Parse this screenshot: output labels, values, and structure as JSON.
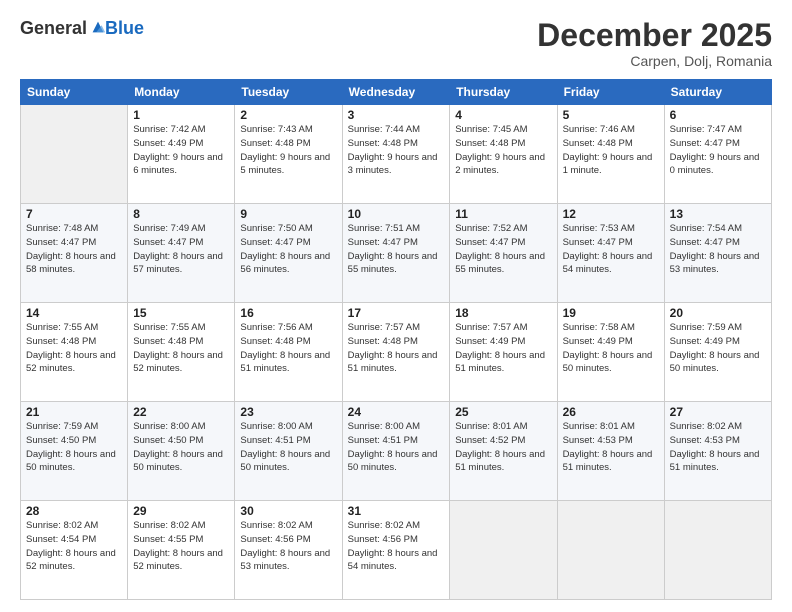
{
  "header": {
    "logo_general": "General",
    "logo_blue": "Blue",
    "month_title": "December 2025",
    "location": "Carpen, Dolj, Romania"
  },
  "days_of_week": [
    "Sunday",
    "Monday",
    "Tuesday",
    "Wednesday",
    "Thursday",
    "Friday",
    "Saturday"
  ],
  "weeks": [
    [
      {
        "day": "",
        "sunrise": "",
        "sunset": "",
        "daylight": "",
        "empty": true
      },
      {
        "day": "1",
        "sunrise": "Sunrise: 7:42 AM",
        "sunset": "Sunset: 4:49 PM",
        "daylight": "Daylight: 9 hours and 6 minutes."
      },
      {
        "day": "2",
        "sunrise": "Sunrise: 7:43 AM",
        "sunset": "Sunset: 4:48 PM",
        "daylight": "Daylight: 9 hours and 5 minutes."
      },
      {
        "day": "3",
        "sunrise": "Sunrise: 7:44 AM",
        "sunset": "Sunset: 4:48 PM",
        "daylight": "Daylight: 9 hours and 3 minutes."
      },
      {
        "day": "4",
        "sunrise": "Sunrise: 7:45 AM",
        "sunset": "Sunset: 4:48 PM",
        "daylight": "Daylight: 9 hours and 2 minutes."
      },
      {
        "day": "5",
        "sunrise": "Sunrise: 7:46 AM",
        "sunset": "Sunset: 4:48 PM",
        "daylight": "Daylight: 9 hours and 1 minute."
      },
      {
        "day": "6",
        "sunrise": "Sunrise: 7:47 AM",
        "sunset": "Sunset: 4:47 PM",
        "daylight": "Daylight: 9 hours and 0 minutes."
      }
    ],
    [
      {
        "day": "7",
        "sunrise": "Sunrise: 7:48 AM",
        "sunset": "Sunset: 4:47 PM",
        "daylight": "Daylight: 8 hours and 58 minutes."
      },
      {
        "day": "8",
        "sunrise": "Sunrise: 7:49 AM",
        "sunset": "Sunset: 4:47 PM",
        "daylight": "Daylight: 8 hours and 57 minutes."
      },
      {
        "day": "9",
        "sunrise": "Sunrise: 7:50 AM",
        "sunset": "Sunset: 4:47 PM",
        "daylight": "Daylight: 8 hours and 56 minutes."
      },
      {
        "day": "10",
        "sunrise": "Sunrise: 7:51 AM",
        "sunset": "Sunset: 4:47 PM",
        "daylight": "Daylight: 8 hours and 55 minutes."
      },
      {
        "day": "11",
        "sunrise": "Sunrise: 7:52 AM",
        "sunset": "Sunset: 4:47 PM",
        "daylight": "Daylight: 8 hours and 55 minutes."
      },
      {
        "day": "12",
        "sunrise": "Sunrise: 7:53 AM",
        "sunset": "Sunset: 4:47 PM",
        "daylight": "Daylight: 8 hours and 54 minutes."
      },
      {
        "day": "13",
        "sunrise": "Sunrise: 7:54 AM",
        "sunset": "Sunset: 4:47 PM",
        "daylight": "Daylight: 8 hours and 53 minutes."
      }
    ],
    [
      {
        "day": "14",
        "sunrise": "Sunrise: 7:55 AM",
        "sunset": "Sunset: 4:48 PM",
        "daylight": "Daylight: 8 hours and 52 minutes."
      },
      {
        "day": "15",
        "sunrise": "Sunrise: 7:55 AM",
        "sunset": "Sunset: 4:48 PM",
        "daylight": "Daylight: 8 hours and 52 minutes."
      },
      {
        "day": "16",
        "sunrise": "Sunrise: 7:56 AM",
        "sunset": "Sunset: 4:48 PM",
        "daylight": "Daylight: 8 hours and 51 minutes."
      },
      {
        "day": "17",
        "sunrise": "Sunrise: 7:57 AM",
        "sunset": "Sunset: 4:48 PM",
        "daylight": "Daylight: 8 hours and 51 minutes."
      },
      {
        "day": "18",
        "sunrise": "Sunrise: 7:57 AM",
        "sunset": "Sunset: 4:49 PM",
        "daylight": "Daylight: 8 hours and 51 minutes."
      },
      {
        "day": "19",
        "sunrise": "Sunrise: 7:58 AM",
        "sunset": "Sunset: 4:49 PM",
        "daylight": "Daylight: 8 hours and 50 minutes."
      },
      {
        "day": "20",
        "sunrise": "Sunrise: 7:59 AM",
        "sunset": "Sunset: 4:49 PM",
        "daylight": "Daylight: 8 hours and 50 minutes."
      }
    ],
    [
      {
        "day": "21",
        "sunrise": "Sunrise: 7:59 AM",
        "sunset": "Sunset: 4:50 PM",
        "daylight": "Daylight: 8 hours and 50 minutes."
      },
      {
        "day": "22",
        "sunrise": "Sunrise: 8:00 AM",
        "sunset": "Sunset: 4:50 PM",
        "daylight": "Daylight: 8 hours and 50 minutes."
      },
      {
        "day": "23",
        "sunrise": "Sunrise: 8:00 AM",
        "sunset": "Sunset: 4:51 PM",
        "daylight": "Daylight: 8 hours and 50 minutes."
      },
      {
        "day": "24",
        "sunrise": "Sunrise: 8:00 AM",
        "sunset": "Sunset: 4:51 PM",
        "daylight": "Daylight: 8 hours and 50 minutes."
      },
      {
        "day": "25",
        "sunrise": "Sunrise: 8:01 AM",
        "sunset": "Sunset: 4:52 PM",
        "daylight": "Daylight: 8 hours and 51 minutes."
      },
      {
        "day": "26",
        "sunrise": "Sunrise: 8:01 AM",
        "sunset": "Sunset: 4:53 PM",
        "daylight": "Daylight: 8 hours and 51 minutes."
      },
      {
        "day": "27",
        "sunrise": "Sunrise: 8:02 AM",
        "sunset": "Sunset: 4:53 PM",
        "daylight": "Daylight: 8 hours and 51 minutes."
      }
    ],
    [
      {
        "day": "28",
        "sunrise": "Sunrise: 8:02 AM",
        "sunset": "Sunset: 4:54 PM",
        "daylight": "Daylight: 8 hours and 52 minutes."
      },
      {
        "day": "29",
        "sunrise": "Sunrise: 8:02 AM",
        "sunset": "Sunset: 4:55 PM",
        "daylight": "Daylight: 8 hours and 52 minutes."
      },
      {
        "day": "30",
        "sunrise": "Sunrise: 8:02 AM",
        "sunset": "Sunset: 4:56 PM",
        "daylight": "Daylight: 8 hours and 53 minutes."
      },
      {
        "day": "31",
        "sunrise": "Sunrise: 8:02 AM",
        "sunset": "Sunset: 4:56 PM",
        "daylight": "Daylight: 8 hours and 54 minutes."
      },
      {
        "day": "",
        "sunrise": "",
        "sunset": "",
        "daylight": "",
        "empty": true
      },
      {
        "day": "",
        "sunrise": "",
        "sunset": "",
        "daylight": "",
        "empty": true
      },
      {
        "day": "",
        "sunrise": "",
        "sunset": "",
        "daylight": "",
        "empty": true
      }
    ]
  ]
}
